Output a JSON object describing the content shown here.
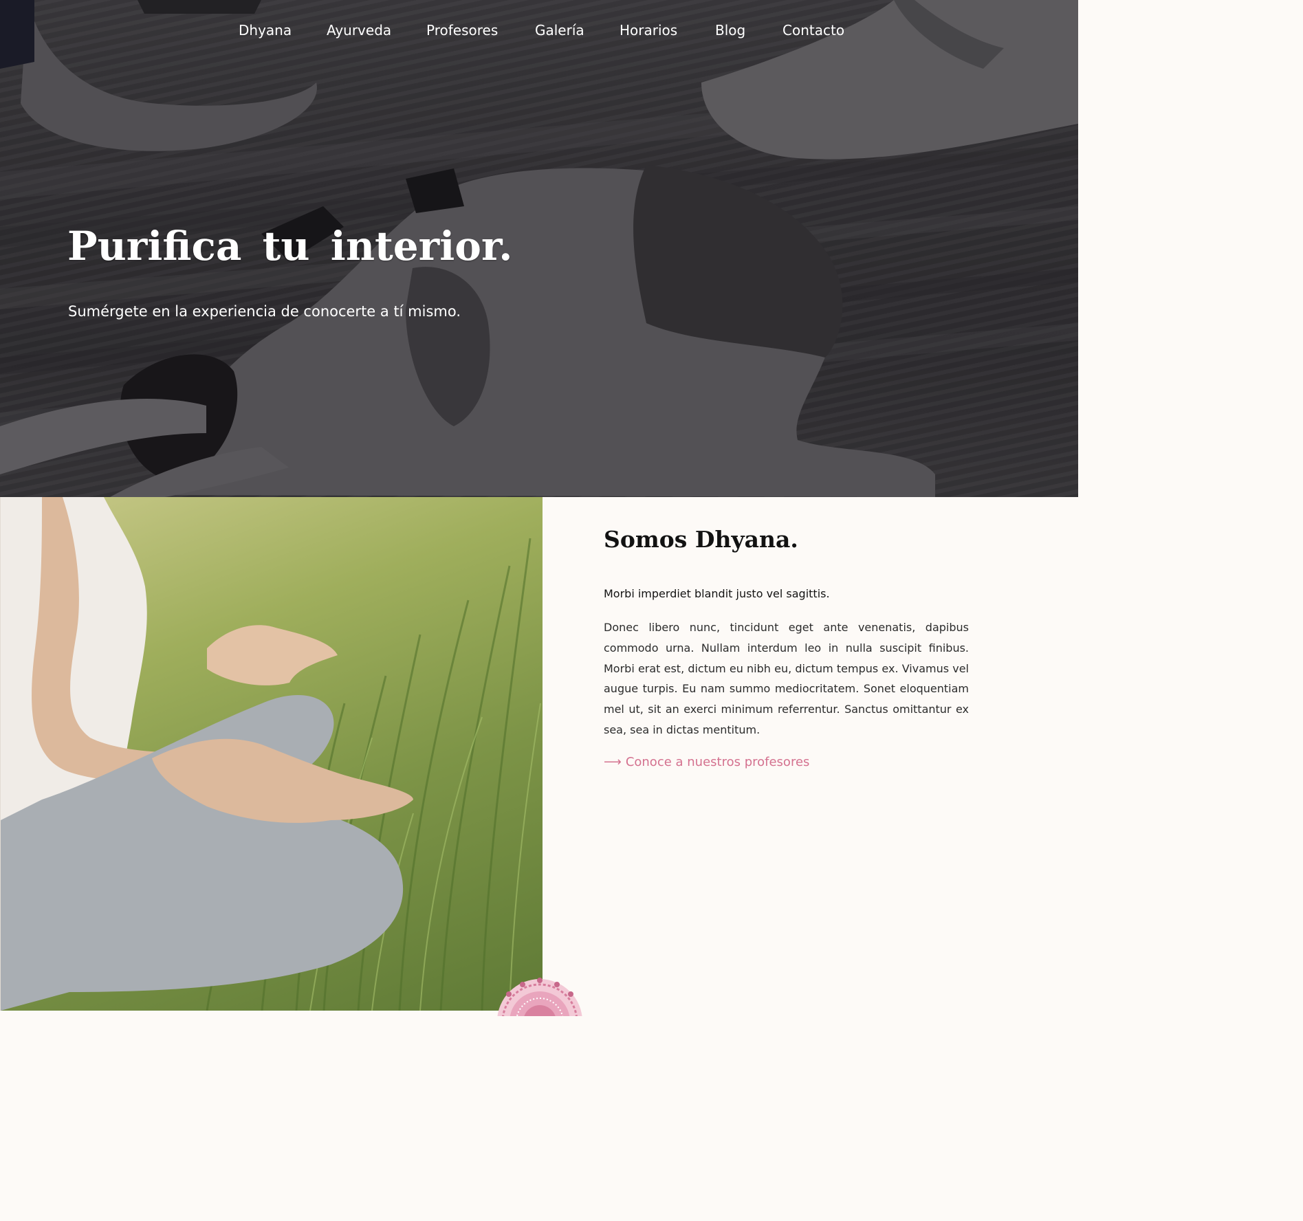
{
  "nav": {
    "items": [
      {
        "id": "dhyana",
        "label": "Dhyana"
      },
      {
        "id": "ayurveda",
        "label": "Ayurveda"
      },
      {
        "id": "profesores",
        "label": "Profesores"
      },
      {
        "id": "galeria",
        "label": "Galería"
      },
      {
        "id": "horarios",
        "label": "Horarios"
      },
      {
        "id": "blog",
        "label": "Blog"
      },
      {
        "id": "contacto",
        "label": "Contacto"
      }
    ]
  },
  "hero": {
    "title": "Purifica tu interior.",
    "subtitle": "Sumérgete en la experiencia de conocerte a tí mismo."
  },
  "about": {
    "title": "Somos Dhyana.",
    "lead": "Morbi imperdiet blandit justo vel sagittis.",
    "body": "Donec libero nunc, tincidunt eget ante venenatis, dapibus commodo urna. Nullam interdum leo in nulla suscipit finibus. Morbi erat est, dictum eu nibh eu, dictum tempus ex. Vivamus vel augue turpis. Eu nam summo mediocritatem. Sonet eloquentiam mel ut, sit an exerci minimum referrentur. Sanctus omittantur ex sea, sea in dictas mentitum.",
    "link_arrow": "⟶",
    "link_label": "Conoce a nuestros profesores"
  },
  "colors": {
    "accent": "#d4718f",
    "panel_bg": "#fdfaf7",
    "text_dark": "#121212"
  }
}
